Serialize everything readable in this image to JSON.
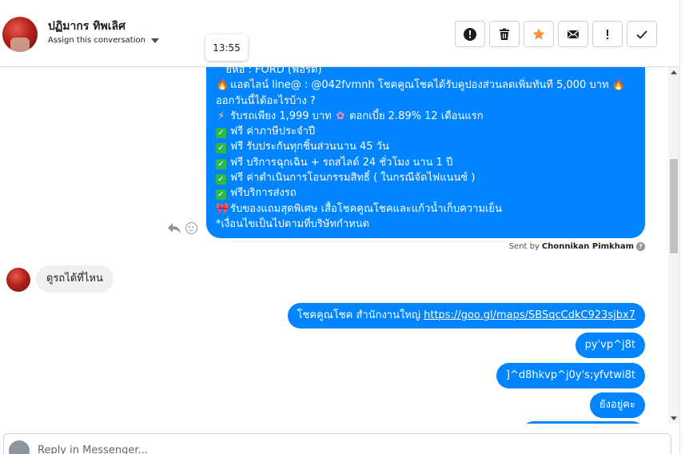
{
  "header": {
    "contact_name": "ปฏิมากร ทิพเลิศ",
    "assign_label": "Assign this conversation",
    "actions": [
      {
        "icon": "alert-circle-icon",
        "name": "mark-spam-button"
      },
      {
        "icon": "trash-icon",
        "name": "delete-button"
      },
      {
        "icon": "star-icon",
        "name": "star-button"
      },
      {
        "icon": "envelope-icon",
        "name": "mark-unread-button"
      },
      {
        "icon": "exclamation-icon",
        "name": "mark-important-button"
      },
      {
        "icon": "check-icon",
        "name": "mark-done-button"
      }
    ],
    "accent_colors": {
      "star": "#f7923a",
      "bubble": "#0084ff"
    }
  },
  "tooltip": {
    "time": "13:55"
  },
  "messages": {
    "big": {
      "lines": [
        "ยี่ห้อ : FORD (ฟอร์ด)",
        "แอดไลน์ line@ : @042fvmnh โชคคูณโชคได้รับคูปองส่วนลดเพิ่มทันที 5,000 บาท",
        "ออกวันนี้ได้อะไรบ้าง ?",
        "รับรถเพียง 1,999 บาท",
        "ดอกเบี้ย 2.89% 12 เดือนแรก",
        "ฟรี ค่าภาษีประจำปี",
        "ฟรี รับประกันทุกชิ้นส่วนนาน 45 วัน",
        "ฟรี บริการฉุกเฉิน + รถสไลด์ 24 ชั่วโมง นาน 1 ปี",
        "ฟรี ค่าดำเนินการโอนกรรมสิทธิ์ ( ในกรณีจัดไฟแนนซ์ )",
        "ฟรีบริการส่งรถ",
        "รับของแถมสุดพิเศษ เสื้อโชคคูณโชคและแก้วน้ำเก็บความเย็น",
        "*เงื่อนไขเป็นไปตามที่บริษัทกำหนด"
      ]
    },
    "sent_by_prefix": "Sent by",
    "sent_by_name": "Chonnikan Pimkham",
    "incoming": "ดูรถได้ที่ไหน",
    "out1_text": "โชคคูณโชค สำนักงานใหญ่ ",
    "out1_link": "https://goo.gl/maps/SBSqcCdkC923sjbx7",
    "out2": "py'vp^j8t",
    "out3": "]^d8hkvp^j0y's;yfvtwi8t",
    "out4": "ยังอยู่คะ"
  },
  "composer": {
    "placeholder": "Reply in Messenger..."
  }
}
